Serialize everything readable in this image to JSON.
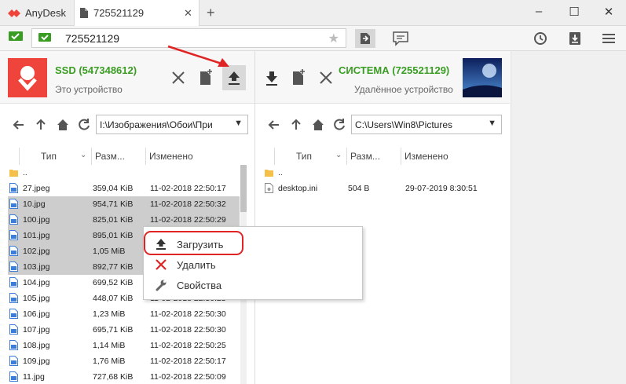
{
  "app": {
    "name": "AnyDesk",
    "brand_color": "#ef443b",
    "accent_green": "#3a9d23"
  },
  "tab": {
    "label": "725521129",
    "close_glyph": "✕",
    "add_glyph": "+"
  },
  "window": {
    "minimize": "–",
    "maximize": "☐",
    "close": "✕"
  },
  "address": {
    "value": "725521129"
  },
  "local": {
    "name": "SSD (547348612)",
    "subtitle": "Это устройство",
    "path": "I:\\Изображения\\Обои\\При",
    "columns": {
      "type": "Тип",
      "size": "Разм...",
      "modified": "Изменено"
    },
    "files": [
      {
        "name": "..",
        "size": "",
        "date": "",
        "icon": "folder-icon",
        "selected": false
      },
      {
        "name": "27.jpeg",
        "size": "359,04 KiB",
        "date": "11-02-2018 22:50:17",
        "icon": "image-file-icon",
        "selected": false
      },
      {
        "name": "10.jpg",
        "size": "954,71 KiB",
        "date": "11-02-2018 22:50:32",
        "icon": "image-file-icon",
        "selected": true
      },
      {
        "name": "100.jpg",
        "size": "825,01 KiB",
        "date": "11-02-2018 22:50:29",
        "icon": "image-file-icon",
        "selected": true
      },
      {
        "name": "101.jpg",
        "size": "895,01 KiB",
        "date": "11-02-2018 22:50:31",
        "icon": "image-file-icon",
        "selected": true
      },
      {
        "name": "102.jpg",
        "size": "1,05 MiB",
        "date": "11-02-2018 22:50:32",
        "icon": "image-file-icon",
        "selected": true
      },
      {
        "name": "103.jpg",
        "size": "892,77 KiB",
        "date": "11-02-2018 22:50:30",
        "icon": "image-file-icon",
        "selected": true
      },
      {
        "name": "104.jpg",
        "size": "699,52 KiB",
        "date": "11-02-2018 22:50:31",
        "icon": "image-file-icon",
        "selected": false
      },
      {
        "name": "105.jpg",
        "size": "448,07 KiB",
        "date": "11-02-2018 22:50:25",
        "icon": "image-file-icon",
        "selected": false
      },
      {
        "name": "106.jpg",
        "size": "1,23 MiB",
        "date": "11-02-2018 22:50:30",
        "icon": "image-file-icon",
        "selected": false
      },
      {
        "name": "107.jpg",
        "size": "695,71 KiB",
        "date": "11-02-2018 22:50:30",
        "icon": "image-file-icon",
        "selected": false
      },
      {
        "name": "108.jpg",
        "size": "1,14 MiB",
        "date": "11-02-2018 22:50:25",
        "icon": "image-file-icon",
        "selected": false
      },
      {
        "name": "109.jpg",
        "size": "1,76 MiB",
        "date": "11-02-2018 22:50:17",
        "icon": "image-file-icon",
        "selected": false
      },
      {
        "name": "11.jpg",
        "size": "727,68 KiB",
        "date": "11-02-2018 22:50:09",
        "icon": "image-file-icon",
        "selected": false
      }
    ]
  },
  "remote": {
    "name": "СИСТЕМА (725521129)",
    "subtitle": "Удалённое устройство",
    "path": "C:\\Users\\Win8\\Pictures",
    "columns": {
      "type": "Тип",
      "size": "Разм...",
      "modified": "Изменено"
    },
    "files": [
      {
        "name": "..",
        "size": "",
        "date": "",
        "icon": "folder-icon"
      },
      {
        "name": "desktop.ini",
        "size": "504 B",
        "date": "29-07-2019 8:30:51",
        "icon": "ini-file-icon"
      }
    ]
  },
  "context_menu": {
    "items": [
      {
        "label": "Загрузить",
        "icon": "upload-icon"
      },
      {
        "label": "Удалить",
        "icon": "delete-x-icon"
      },
      {
        "label": "Свойства",
        "icon": "wrench-icon"
      }
    ],
    "highlight_color": "#e02424"
  }
}
